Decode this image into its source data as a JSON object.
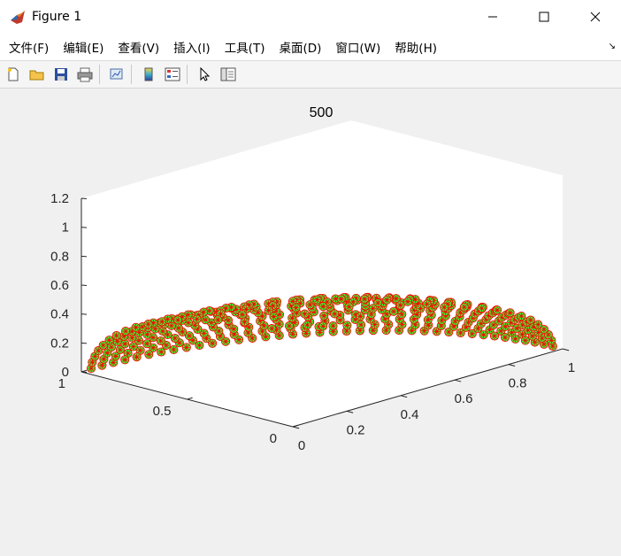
{
  "window": {
    "title": "Figure 1",
    "controls": [
      "minimize",
      "maximize",
      "close"
    ]
  },
  "menu": {
    "items": [
      "文件(F)",
      "编辑(E)",
      "查看(V)",
      "插入(I)",
      "工具(T)",
      "桌面(D)",
      "窗口(W)",
      "帮助(H)"
    ],
    "overflow_icon": "dock-arrow-icon"
  },
  "toolbar": {
    "icons": [
      "new-figure-icon",
      "open-file-icon",
      "save-icon",
      "print-icon",
      "link-plot-icon",
      "colorbar-icon",
      "legend-icon",
      "pointer-icon",
      "property-inspector-icon"
    ]
  },
  "colors": {
    "marker_edge": "#ff0000",
    "marker_face": "#33ff33",
    "background": "#f0f0f0",
    "axes_face": "#ffffff"
  },
  "chart_data": {
    "type": "scatter",
    "view": "3d",
    "title": "500",
    "grid": false,
    "xlim": [
      0,
      1
    ],
    "ylim": [
      0,
      1
    ],
    "zlim": [
      0,
      1.2
    ],
    "xticks": [
      "0",
      "0.2",
      "0.4",
      "0.6",
      "0.8",
      "1"
    ],
    "yticks": [
      "0",
      "0.5",
      "1"
    ],
    "zticks": [
      "0",
      "0.2",
      "0.4",
      "0.6",
      "0.8",
      "1",
      "1.2"
    ],
    "markers": "circle + asterisk",
    "surface": "spherical cap points on unit sphere quarter, x in [0,1], y in [0,1], z>=0",
    "point_count": 500
  }
}
